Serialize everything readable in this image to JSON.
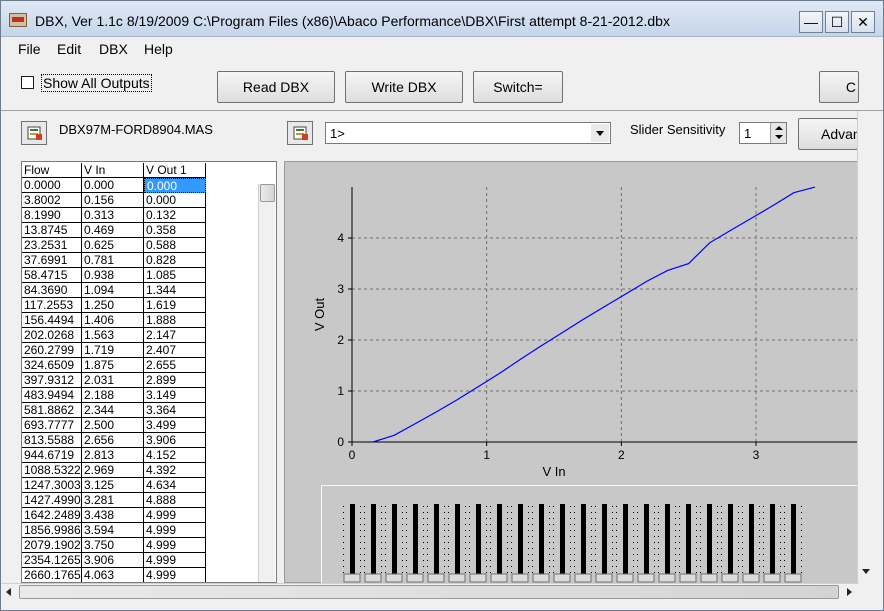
{
  "window": {
    "title": "DBX, Ver 1.1c 8/19/2009  C:\\Program Files (x86)\\Abaco Performance\\DBX\\First attempt 8-21-2012.dbx",
    "controls": {
      "minimize": "—",
      "maximize": "☐",
      "close": "✕"
    }
  },
  "menu": {
    "file": "File",
    "edit": "Edit",
    "dbx": "DBX",
    "help": "Help"
  },
  "toolbar": {
    "show_all_outputs": "Show All Outputs",
    "read_dbx": "Read DBX",
    "write_dbx": "Write DBX",
    "switch": "Switch=",
    "partial_button": "C"
  },
  "secondbar": {
    "file_name": "DBX97M-FORD8904.MAS",
    "output_select": "1>",
    "slider_sensitivity_label": "Slider Sensitivity",
    "slider_sensitivity_value": "1",
    "advanced_button": "Advan"
  },
  "table": {
    "headers": [
      "Flow",
      "V In",
      "V Out 1"
    ],
    "rows": [
      [
        "0.0000",
        "0.000",
        "0.000"
      ],
      [
        "3.8002",
        "0.156",
        "0.000"
      ],
      [
        "8.1990",
        "0.313",
        "0.132"
      ],
      [
        "13.8745",
        "0.469",
        "0.358"
      ],
      [
        "23.2531",
        "0.625",
        "0.588"
      ],
      [
        "37.6991",
        "0.781",
        "0.828"
      ],
      [
        "58.4715",
        "0.938",
        "1.085"
      ],
      [
        "84.3690",
        "1.094",
        "1.344"
      ],
      [
        "117.2553",
        "1.250",
        "1.619"
      ],
      [
        "156.4494",
        "1.406",
        "1.888"
      ],
      [
        "202.0268",
        "1.563",
        "2.147"
      ],
      [
        "260.2799",
        "1.719",
        "2.407"
      ],
      [
        "324.6509",
        "1.875",
        "2.655"
      ],
      [
        "397.9312",
        "2.031",
        "2.899"
      ],
      [
        "483.9494",
        "2.188",
        "3.149"
      ],
      [
        "581.8862",
        "2.344",
        "3.364"
      ],
      [
        "693.7777",
        "2.500",
        "3.499"
      ],
      [
        "813.5588",
        "2.656",
        "3.906"
      ],
      [
        "944.6719",
        "2.813",
        "4.152"
      ],
      [
        "1088.5322",
        "2.969",
        "4.392"
      ],
      [
        "1247.3003",
        "3.125",
        "4.634"
      ],
      [
        "1427.4990",
        "3.281",
        "4.888"
      ],
      [
        "1642.2489",
        "3.438",
        "4.999"
      ],
      [
        "1856.9986",
        "3.594",
        "4.999"
      ],
      [
        "2079.1902",
        "3.750",
        "4.999"
      ],
      [
        "2354.1265",
        "3.906",
        "4.999"
      ],
      [
        "2660.1765",
        "4.063",
        "4.999"
      ]
    ]
  },
  "chart_data": {
    "type": "line",
    "xlabel": "V In",
    "ylabel": "V Out",
    "xlim": [
      0,
      3.75
    ],
    "ylim": [
      0,
      5
    ],
    "xticks": [
      "0",
      "1",
      "2",
      "3"
    ],
    "yticks": [
      "0",
      "1",
      "2",
      "3",
      "4"
    ],
    "grid": true,
    "line_color": "#0000ff",
    "x": [
      0.156,
      0.313,
      0.469,
      0.625,
      0.781,
      0.938,
      1.094,
      1.25,
      1.406,
      1.563,
      1.719,
      1.875,
      2.031,
      2.188,
      2.344,
      2.5,
      2.656,
      2.813,
      2.969,
      3.125,
      3.281,
      3.438
    ],
    "y": [
      0.0,
      0.132,
      0.358,
      0.588,
      0.828,
      1.085,
      1.344,
      1.619,
      1.888,
      2.147,
      2.407,
      2.655,
      2.899,
      3.149,
      3.364,
      3.499,
      3.906,
      4.152,
      4.392,
      4.634,
      4.888,
      4.999
    ]
  }
}
